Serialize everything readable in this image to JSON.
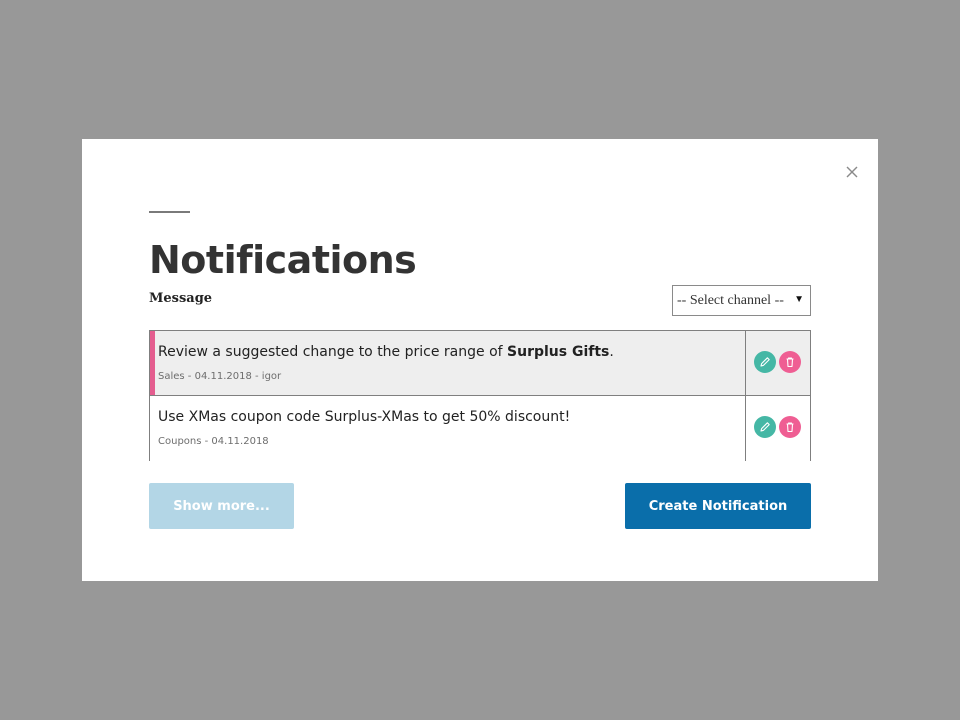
{
  "modal": {
    "title": "Notifications",
    "subhead": "Message",
    "close_icon": "close-icon",
    "channel_select": {
      "value": "-- Select channel --",
      "icon": "caret-down-icon"
    }
  },
  "notifications": [
    {
      "message_prefix": "Review a suggested change to the price range of ",
      "message_bold": "Surplus Gifts",
      "message_suffix": ".",
      "meta": "Sales - 04.11.2018 - igor",
      "unread": true,
      "marker_color": "#e45d8f"
    },
    {
      "message_prefix": "Use XMas coupon code Surplus-XMas to get 50% discount!",
      "message_bold": "",
      "message_suffix": "",
      "meta": "Coupons - 04.11.2018",
      "unread": false
    }
  ],
  "actions": {
    "edit_icon": "pencil-icon",
    "delete_icon": "trash-icon"
  },
  "footer": {
    "show_more_label": "Show more...",
    "create_label": "Create Notification"
  },
  "colors": {
    "edit": "#45b7a5",
    "delete": "#ef5e93",
    "primary": "#0a6eaa",
    "disabled": "#b3d6e6",
    "overlay": "#989898"
  }
}
